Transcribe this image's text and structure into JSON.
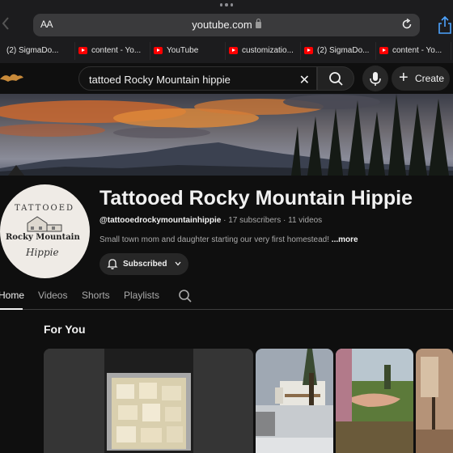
{
  "browser": {
    "aa_label": "AA",
    "url": "youtube.com",
    "tabs": [
      {
        "label": "(2) SigmaDo..."
      },
      {
        "label": "content - Yo..."
      },
      {
        "label": "YouTube"
      },
      {
        "label": "customizatio..."
      },
      {
        "label": "(2) SigmaDo..."
      },
      {
        "label": "content - Yo..."
      }
    ]
  },
  "header": {
    "search_query": "tattoed Rocky Mountain hippie",
    "create_label": "Create"
  },
  "channel": {
    "name": "Tattooed Rocky Mountain Hippie",
    "handle": "@tattooedrockymountainhippie",
    "subscribers": " · 17 subscribers",
    "videos": " · 11 videos",
    "description": "Small town mom and daughter starting our very first homestead! ",
    "more_label": "...more",
    "subscribed_label": "Subscribed",
    "avatar_text": {
      "line1": "TATTOOED",
      "line2": "Rocky Mountain",
      "line3": "Hippie"
    }
  },
  "tabs": [
    {
      "label": "Home"
    },
    {
      "label": "Videos"
    },
    {
      "label": "Shorts"
    },
    {
      "label": "Playlists"
    }
  ],
  "section": {
    "title": "For You"
  },
  "colors": {
    "background": "#0f0f0f",
    "youtube_red": "#ff0000",
    "text_primary": "#f1f1f1",
    "text_secondary": "#aaaaaa"
  }
}
